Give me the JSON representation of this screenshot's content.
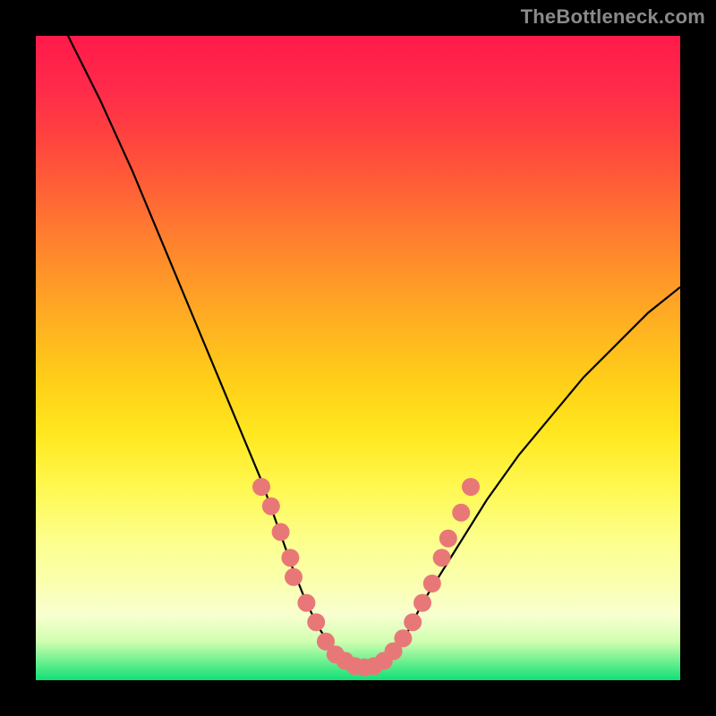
{
  "watermark": "TheBottleneck.com",
  "chart_data": {
    "type": "line",
    "title": "",
    "xlabel": "",
    "ylabel": "",
    "xlim": [
      0,
      100
    ],
    "ylim": [
      0,
      100
    ],
    "grid": false,
    "legend": false,
    "series": [
      {
        "name": "bottleneck-curve",
        "color": "#000000",
        "x": [
          5,
          10,
          15,
          20,
          25,
          30,
          35,
          40,
          42,
          44,
          46,
          48,
          50,
          52,
          54,
          56,
          58,
          60,
          65,
          70,
          75,
          80,
          85,
          90,
          95,
          100
        ],
        "y": [
          100,
          90,
          79,
          67,
          55,
          43,
          31,
          17,
          12,
          8,
          5,
          3,
          2,
          2,
          3,
          5,
          8,
          12,
          20,
          28,
          35,
          41,
          47,
          52,
          57,
          61
        ]
      }
    ],
    "markers": [
      {
        "name": "highlight-points",
        "color": "#e87878",
        "radius": 10,
        "points": [
          {
            "x": 35,
            "y": 30
          },
          {
            "x": 36.5,
            "y": 27
          },
          {
            "x": 38,
            "y": 23
          },
          {
            "x": 39.5,
            "y": 19
          },
          {
            "x": 40,
            "y": 16
          },
          {
            "x": 42,
            "y": 12
          },
          {
            "x": 43.5,
            "y": 9
          },
          {
            "x": 45,
            "y": 6
          },
          {
            "x": 46.5,
            "y": 4
          },
          {
            "x": 48,
            "y": 3
          },
          {
            "x": 49.5,
            "y": 2.2
          },
          {
            "x": 51,
            "y": 2
          },
          {
            "x": 52.5,
            "y": 2.2
          },
          {
            "x": 54,
            "y": 3
          },
          {
            "x": 55.5,
            "y": 4.5
          },
          {
            "x": 57,
            "y": 6.5
          },
          {
            "x": 58.5,
            "y": 9
          },
          {
            "x": 60,
            "y": 12
          },
          {
            "x": 61.5,
            "y": 15
          },
          {
            "x": 63,
            "y": 19
          },
          {
            "x": 64,
            "y": 22
          },
          {
            "x": 66,
            "y": 26
          },
          {
            "x": 67.5,
            "y": 30
          }
        ]
      }
    ],
    "background_gradient": {
      "top": "#ff1a4a",
      "bottom": "#10e078"
    }
  }
}
